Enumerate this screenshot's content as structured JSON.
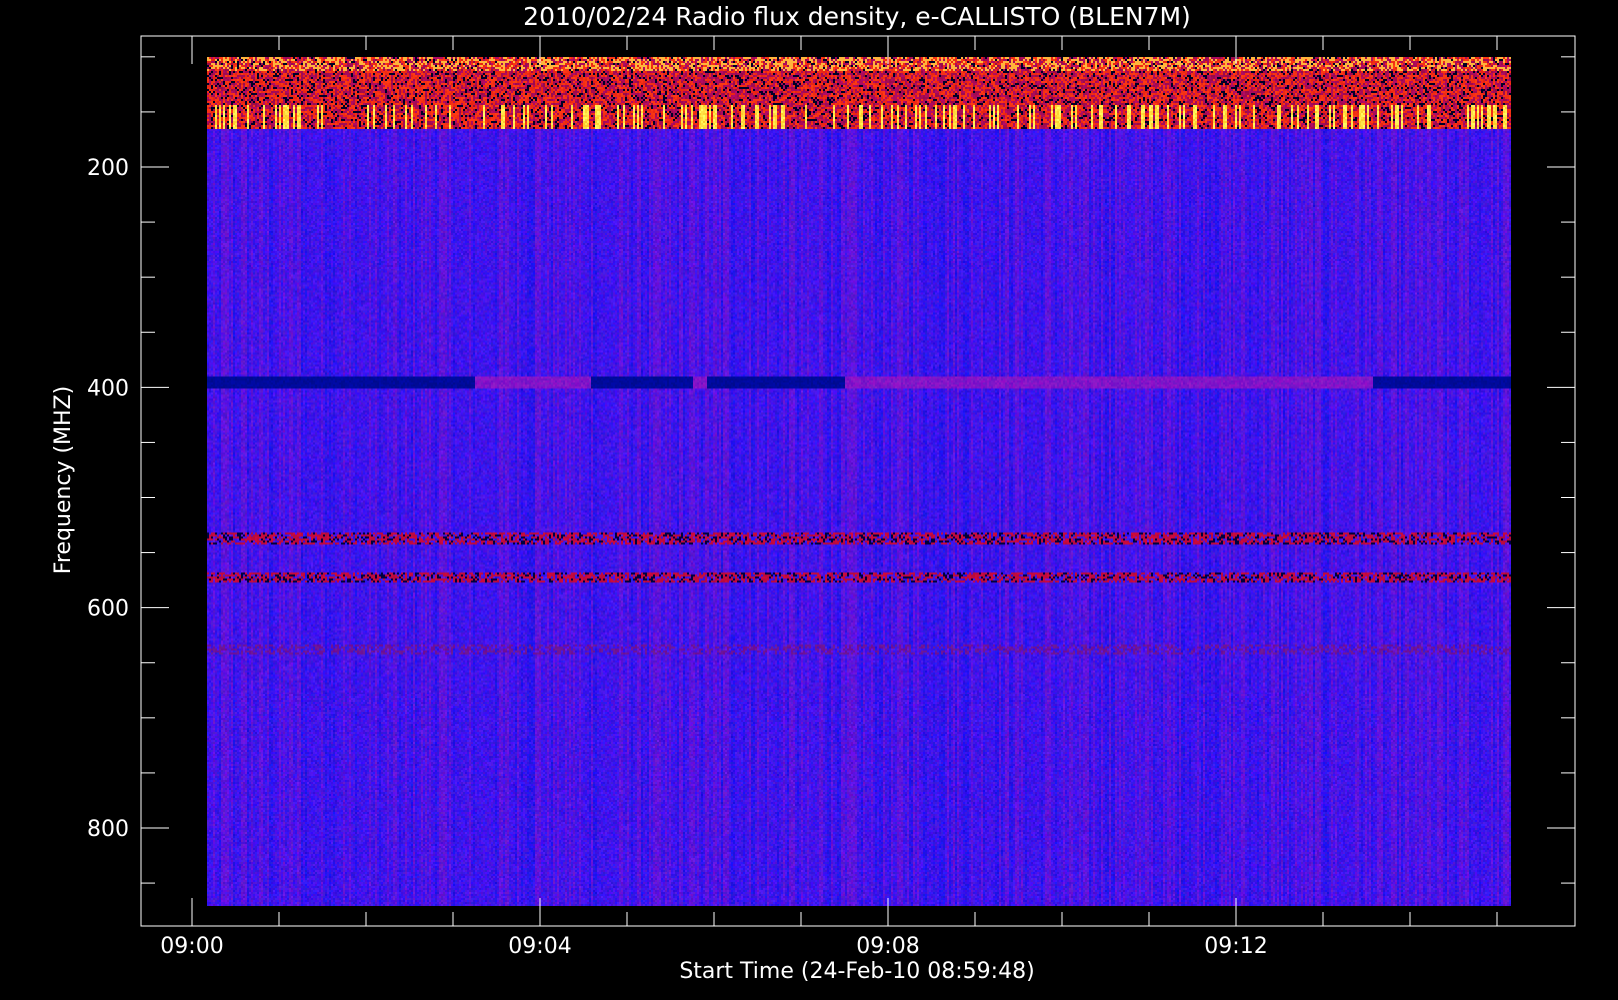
{
  "chart_data": {
    "type": "heatmap",
    "title": "2010/02/24  Radio flux density, e-CALLISTO (BLEN7M)",
    "xlabel": "Start Time (24-Feb-10 08:59:48)",
    "ylabel": "Frequency (MHZ)",
    "x_range": [
      "08:59:48",
      "09:15:00"
    ],
    "x_ticks": [
      "09:00",
      "09:04",
      "09:08",
      "09:12"
    ],
    "ylim": [
      870,
      100
    ],
    "y_ticks": [
      200,
      400,
      600,
      800
    ],
    "data_extent": {
      "time_start": "09:00:10",
      "time_end": "09:15:10",
      "freq_min": 108,
      "freq_max": 870
    },
    "colormap": [
      "#000000",
      "#0000ff",
      "#ff0000",
      "#ffff00",
      "#ffffff"
    ],
    "background_color": "#3010f0",
    "features": [
      {
        "type": "broadband-interference",
        "freq_range": [
          108,
          172
        ],
        "note": "bright red/yellow intermittent bursts"
      },
      {
        "type": "narrow-band",
        "freq": 400,
        "segments": [
          [
            "09:00:10",
            "09:03:15"
          ],
          [
            "09:04:35",
            "09:05:45"
          ],
          [
            "09:05:55",
            "09:07:30"
          ],
          [
            "09:13:35",
            "09:15:10"
          ]
        ]
      },
      {
        "type": "narrow-band",
        "freq": 540,
        "strength": "medium"
      },
      {
        "type": "narrow-band",
        "freq": 575,
        "strength": "medium"
      },
      {
        "type": "narrow-band",
        "freq": 640,
        "strength": "weak"
      }
    ]
  }
}
